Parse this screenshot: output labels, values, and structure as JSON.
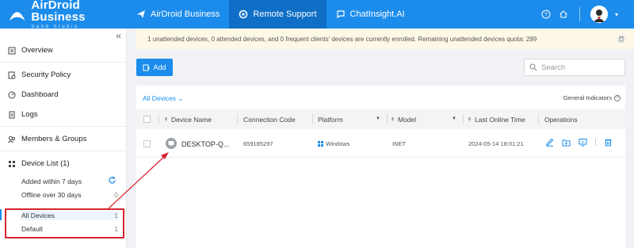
{
  "app": {
    "logo_title": "AirDroid Business",
    "logo_subtitle": "Sand Studio"
  },
  "topnav": [
    {
      "label": "AirDroid Business",
      "icon": "send-icon"
    },
    {
      "label": "Remote Support",
      "icon": "support-icon"
    },
    {
      "label": "ChatInsight.AI",
      "icon": "chat-icon"
    }
  ],
  "top_right": {
    "icons": [
      "help-icon",
      "home-icon",
      "avatar"
    ]
  },
  "sidebar": {
    "collapse_icon": "«",
    "items": [
      {
        "label": "Overview",
        "icon": "overview-icon"
      },
      {
        "label": "Security Policy",
        "icon": "security-icon"
      },
      {
        "label": "Dashboard",
        "icon": "dashboard-icon"
      },
      {
        "label": "Logs",
        "icon": "logs-icon"
      },
      {
        "label": "Members & Groups",
        "icon": "members-icon"
      },
      {
        "label": "Device List (1)",
        "icon": "device-list-icon"
      }
    ],
    "subitems": [
      {
        "label": "Added within 7 days",
        "count": ""
      },
      {
        "label": "Offline over 30 days",
        "count": "0"
      },
      {
        "label": "All Devices",
        "count": "1"
      },
      {
        "label": "Default",
        "count": "1"
      }
    ]
  },
  "notice": "1 unattended devices, 0 attended devices, and 0 frequent clients' devices are currently enrolled. Remaining unattended devices quota: 299",
  "toolbar": {
    "add_label": "Add"
  },
  "search": {
    "placeholder": "Search",
    "value": ""
  },
  "filter": {
    "label": "All Devices",
    "caret": "⌄"
  },
  "general_indicators": "General Indicators",
  "table": {
    "columns": [
      "Device Name",
      "Connection Code",
      "Platform",
      "Model",
      "Last Online Time",
      "Operations"
    ],
    "rows": [
      {
        "device_name": "DESKTOP-Q...",
        "connection_code": "659185297",
        "platform": "Windows",
        "model": "INET",
        "last_online": "2024-05-14 18:01:21"
      }
    ]
  },
  "colors": {
    "brand": "#1b8ceb",
    "annotation": "#d9232e",
    "notice_bg": "#fdf8e6"
  }
}
